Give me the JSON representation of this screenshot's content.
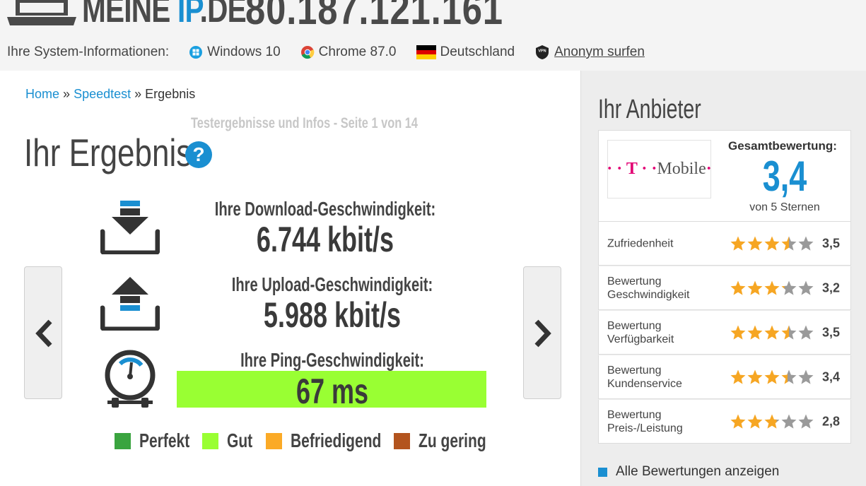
{
  "header": {
    "logo_main": "MEINE ",
    "logo_ip": "IP",
    "logo_tld": ".DE",
    "ip_address": "80.187.121.161",
    "sysinfo_label": "Ihre System-Informationen:",
    "os": "Windows 10",
    "browser": "Chrome 87.0",
    "country": "Deutschland",
    "anon_link": "Anonym surfen",
    "vpn_badge": "VPN"
  },
  "breadcrumb": {
    "home": "Home",
    "sep": "»",
    "speedtest": "Speedtest",
    "current": "Ergebnis"
  },
  "main": {
    "subtitle": "Testergebnisse und Infos - Seite 1 von 14",
    "title": "Ihr Ergebnis",
    "help": "?",
    "download_label": "Ihre Download-Geschwindigkeit:",
    "download_value": "6.744 kbit/s",
    "upload_label": "Ihre Upload-Geschwindigkeit:",
    "upload_value": "5.988 kbit/s",
    "ping_label": "Ihre Ping-Geschwindigkeit:",
    "ping_value": "67 ms",
    "ping_rating_color": "#99ff33",
    "legend": [
      {
        "label": "Perfekt",
        "color": "#3aa43f"
      },
      {
        "label": "Gut",
        "color": "#99ff33"
      },
      {
        "label": "Befriedigend",
        "color": "#fbaa26"
      },
      {
        "label": "Zu gering",
        "color": "#b3541e"
      }
    ]
  },
  "sidebar": {
    "heading": "Ihr Anbieter",
    "provider_brand": "T · · Mobile ·",
    "provider_logo_dots": "· · ",
    "provider_logo_t": "T",
    "provider_logo_mid": " · ·",
    "provider_logo_name": "Mobile",
    "provider_logo_end": "·",
    "overall_label": "Gesamtbewertung:",
    "overall_value": "3,4",
    "overall_scale": "von 5 Sternen",
    "ratings": [
      {
        "label": "Zufriedenheit",
        "value": "3,5",
        "score": 3.5
      },
      {
        "label": "Bewertung Geschwindigkeit",
        "value": "3,2",
        "score": 3.2
      },
      {
        "label": "Bewertung Verfügbarkeit",
        "value": "3,5",
        "score": 3.5
      },
      {
        "label": "Bewertung Kundenservice",
        "value": "3,4",
        "score": 3.4
      },
      {
        "label": "Bewertung Preis-/Leistung",
        "value": "2,8",
        "score": 2.8
      }
    ],
    "all_ratings_link": "Alle Bewertungen anzeigen"
  },
  "colors": {
    "accent": "#1a8fd1",
    "star_full": "#f6a623",
    "star_empty": "#9a9a9a"
  }
}
